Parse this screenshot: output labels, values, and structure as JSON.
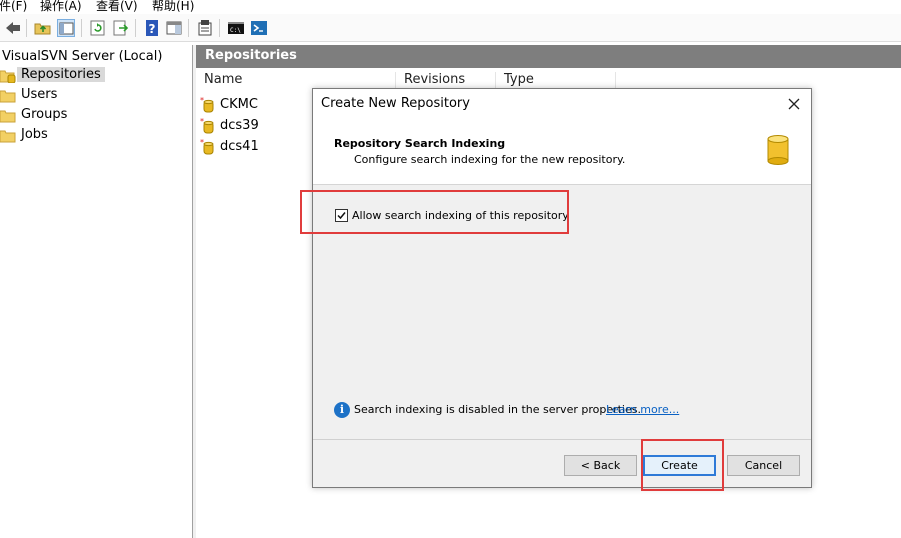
{
  "menubar": {
    "items": [
      "件(F)",
      "操作(A)",
      "查看(V)",
      "帮助(H)"
    ]
  },
  "toolbar": {
    "buttons": [
      "back-arrow-icon",
      "up-folder-icon",
      "show-hide-tree-icon",
      "refresh-icon",
      "export-list-icon",
      "help-icon",
      "action-pane-icon",
      "properties-icon",
      "console-icon",
      "powershell-icon"
    ]
  },
  "tree": {
    "root_label": "VisualSVN Server (Local)",
    "items": [
      {
        "label": "Repositories",
        "selected": true
      },
      {
        "label": "Users",
        "selected": false
      },
      {
        "label": "Groups",
        "selected": false
      },
      {
        "label": "Jobs",
        "selected": false
      }
    ]
  },
  "panel": {
    "header": "Repositories",
    "columns": [
      "Name",
      "Revisions",
      "Type"
    ],
    "rows": [
      "CKMC",
      "dcs39",
      "dcs41"
    ]
  },
  "dialog": {
    "title": "Create New Repository",
    "heading": "Repository Search Indexing",
    "subheading": "Configure search indexing for the new repository.",
    "checkbox_label": "Allow search indexing of this repository",
    "checkbox_checked": true,
    "info_text": "Search indexing is disabled in the server properties.",
    "info_link": "Learn more...",
    "back_label": "< Back",
    "create_label": "Create",
    "cancel_label": "Cancel"
  },
  "colors": {
    "highlight": "#e03c3c",
    "panel_header": "#7e7e7e",
    "link": "#0b62c4",
    "default_button_border": "#2f7ad7"
  }
}
